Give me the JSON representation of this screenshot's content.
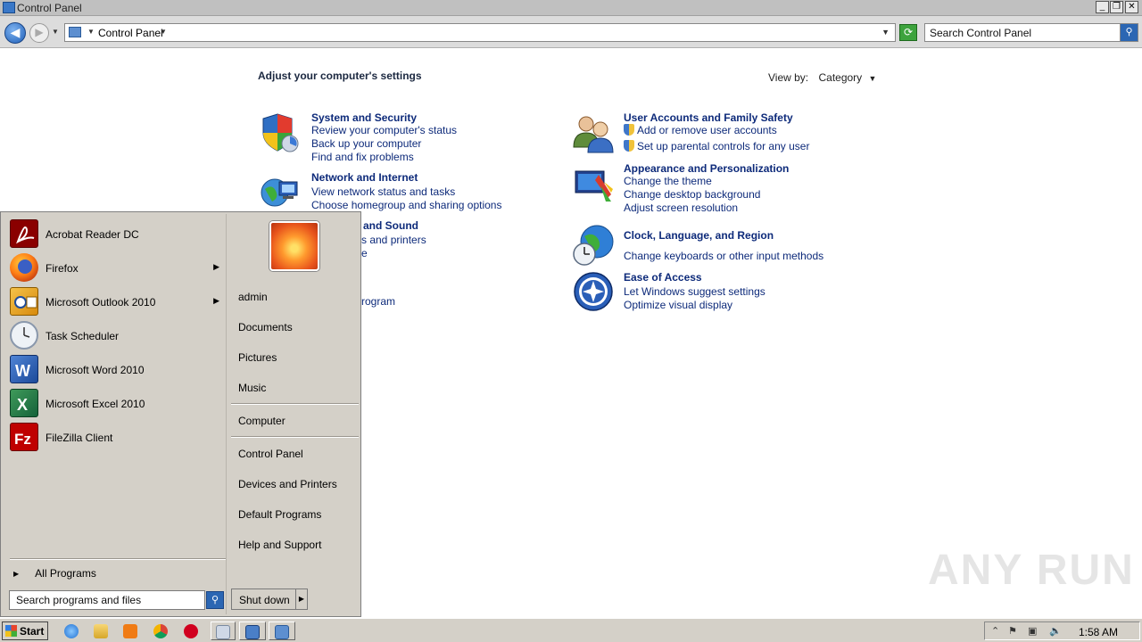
{
  "window": {
    "title": "Control Panel",
    "minimize_glyph": "_",
    "restore_glyph": "❐",
    "close_glyph": "✕"
  },
  "address": {
    "breadcrumb": "Control Panel",
    "search_placeholder": "Search Control Panel"
  },
  "content": {
    "heading": "Adjust your computer's settings",
    "view_by_label": "View by:",
    "view_by_value": "Category",
    "categories": {
      "system_security": {
        "title": "System and Security",
        "links": [
          "Review your computer's status",
          "Back up your computer",
          "Find and fix problems"
        ],
        "icon": "shield-icon"
      },
      "network": {
        "title": "Network and Internet",
        "links": [
          "View network status and tasks",
          "Choose homegroup and sharing options"
        ],
        "icon": "network-globe-icon"
      },
      "hardware": {
        "title_partial": "and Sound",
        "links_partial": [
          "s and printers",
          "e"
        ],
        "icon": "printer-icon"
      },
      "programs": {
        "links_partial": [
          "rogram"
        ],
        "icon": "programs-icon"
      },
      "user_accounts": {
        "title": "User Accounts and Family Safety",
        "links": [
          "Add or remove user accounts",
          "Set up parental controls for any user"
        ],
        "icon": "users-icon"
      },
      "appearance": {
        "title": "Appearance and Personalization",
        "links": [
          "Change the theme",
          "Change desktop background",
          "Adjust screen resolution"
        ],
        "icon": "monitor-paint-icon"
      },
      "clock": {
        "title": "Clock, Language, and Region",
        "links": [
          "Change keyboards or other input methods"
        ],
        "icon": "globe-clock-icon"
      },
      "ease": {
        "title": "Ease of Access",
        "links": [
          "Let Windows suggest settings",
          "Optimize visual display"
        ],
        "icon": "ease-of-access-icon"
      }
    }
  },
  "start_menu": {
    "programs": [
      {
        "label": "Acrobat Reader DC",
        "icon": "acrobat-icon",
        "color": "#b30b00",
        "has_submenu": false
      },
      {
        "label": "Firefox",
        "icon": "firefox-icon",
        "color": "#e66000",
        "has_submenu": true
      },
      {
        "label": "Microsoft Outlook 2010",
        "icon": "outlook-icon",
        "color": "#e8a21a",
        "has_submenu": true
      },
      {
        "label": "Task Scheduler",
        "icon": "clock-icon",
        "color": "#dfe6ee",
        "has_submenu": false
      },
      {
        "label": "Microsoft Word 2010",
        "icon": "word-icon",
        "color": "#2b5797",
        "has_submenu": false
      },
      {
        "label": "Microsoft Excel 2010",
        "icon": "excel-icon",
        "color": "#1e7145",
        "has_submenu": false
      },
      {
        "label": "FileZilla Client",
        "icon": "filezilla-icon",
        "color": "#bf0000",
        "has_submenu": false
      }
    ],
    "submenu_arrow": "▶",
    "all_programs": "All Programs",
    "search_placeholder": "Search programs and files",
    "right_links": {
      "user": "admin",
      "documents": "Documents",
      "pictures": "Pictures",
      "music": "Music",
      "computer": "Computer",
      "control_panel": "Control Panel",
      "devices": "Devices and Printers",
      "default_programs": "Default Programs",
      "help": "Help and Support"
    },
    "shutdown_label": "Shut down"
  },
  "taskbar": {
    "start_label": "Start",
    "clock": "1:58 AM"
  },
  "watermark": "ANY RUN"
}
